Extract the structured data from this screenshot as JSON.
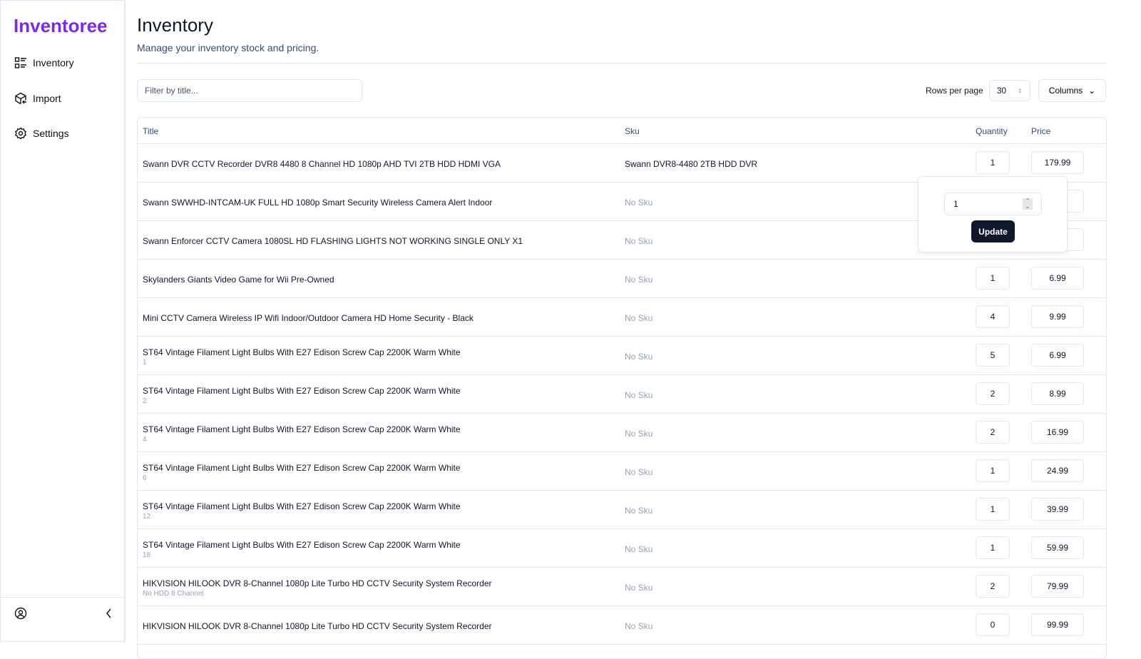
{
  "app": {
    "name": "Inventoree",
    "brand_color": "#7c2ae8"
  },
  "sidebar": {
    "items": [
      {
        "label": "Inventory",
        "icon": "list-icon"
      },
      {
        "label": "Import",
        "icon": "package-import-icon"
      },
      {
        "label": "Settings",
        "icon": "gear-icon"
      }
    ]
  },
  "header": {
    "title": "Inventory",
    "subtitle": "Manage your inventory stock and pricing."
  },
  "toolbar": {
    "filter_placeholder": "Filter by title...",
    "rows_per_page_label": "Rows per page",
    "rows_per_page": "30",
    "columns_label": "Columns"
  },
  "table": {
    "columns": [
      "Title",
      "Sku",
      "Quantity",
      "Price"
    ],
    "rows": [
      {
        "title": "Swann DVR CCTV Recorder DVR8 4480 8 Channel HD 1080p AHD TVI 2TB HDD HDMI VGA",
        "variant": "",
        "sku": "Swann DVR8-4480 2TB HDD DVR",
        "quantity": "1",
        "price": "179.99"
      },
      {
        "title": "Swann SWWHD-INTCAM-UK FULL HD 1080p Smart Security Wireless Camera Alert Indoor",
        "variant": "",
        "sku": "No Sku",
        "quantity": "",
        "price": ""
      },
      {
        "title": "Swann Enforcer CCTV Camera 1080SL HD FLASHING LIGHTS NOT WORKING SINGLE ONLY X1",
        "variant": "",
        "sku": "No Sku",
        "quantity": "",
        "price": ""
      },
      {
        "title": "Skylanders Giants Video Game for Wii Pre-Owned",
        "variant": "",
        "sku": "No Sku",
        "quantity": "1",
        "price": "6.99"
      },
      {
        "title": "Mini CCTV Camera Wireless IP Wifi Indoor/Outdoor Camera HD Home Security - Black",
        "variant": "",
        "sku": "No Sku",
        "quantity": "4",
        "price": "9.99"
      },
      {
        "title": "ST64 Vintage Filament Light Bulbs With E27 Edison Screw Cap 2200K Warm White",
        "variant": "1",
        "sku": "No Sku",
        "quantity": "5",
        "price": "6.99"
      },
      {
        "title": "ST64 Vintage Filament Light Bulbs With E27 Edison Screw Cap 2200K Warm White",
        "variant": "2",
        "sku": "No Sku",
        "quantity": "2",
        "price": "8.99"
      },
      {
        "title": "ST64 Vintage Filament Light Bulbs With E27 Edison Screw Cap 2200K Warm White",
        "variant": "4",
        "sku": "No Sku",
        "quantity": "2",
        "price": "16.99"
      },
      {
        "title": "ST64 Vintage Filament Light Bulbs With E27 Edison Screw Cap 2200K Warm White",
        "variant": "6",
        "sku": "No Sku",
        "quantity": "1",
        "price": "24.99"
      },
      {
        "title": "ST64 Vintage Filament Light Bulbs With E27 Edison Screw Cap 2200K Warm White",
        "variant": "12",
        "sku": "No Sku",
        "quantity": "1",
        "price": "39.99"
      },
      {
        "title": "ST64 Vintage Filament Light Bulbs With E27 Edison Screw Cap 2200K Warm White",
        "variant": "18",
        "sku": "No Sku",
        "quantity": "1",
        "price": "59.99"
      },
      {
        "title": "HIKVISION HILOOK DVR 8-Channel 1080p Lite Turbo HD CCTV Security System Recorder",
        "variant": "No HDD 8 Channel",
        "sku": "No Sku",
        "quantity": "2",
        "price": "79.99"
      },
      {
        "title": "HIKVISION HILOOK DVR 8-Channel 1080p Lite Turbo HD CCTV Security System Recorder",
        "variant": "",
        "sku": "No Sku",
        "quantity": "0",
        "price": "99.99"
      }
    ]
  },
  "popover": {
    "value": "1",
    "button_label": "Update"
  }
}
